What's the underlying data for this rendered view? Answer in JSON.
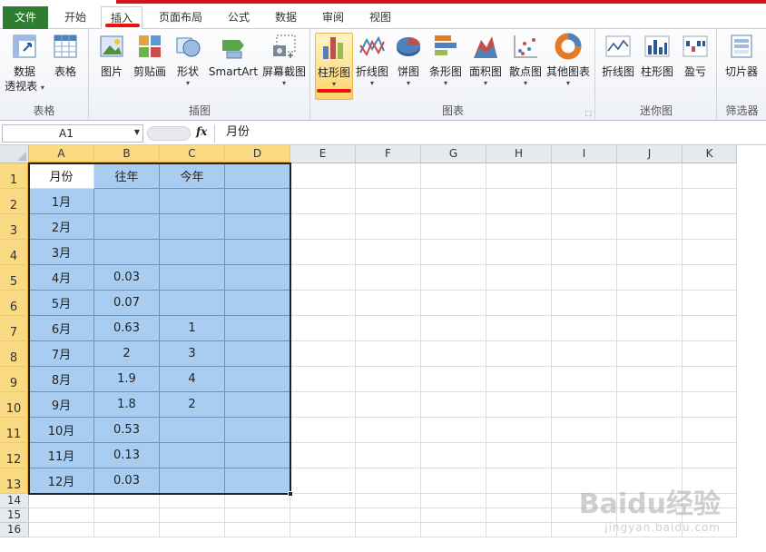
{
  "menu_tabs": {
    "file": "文件",
    "home": "开始",
    "insert": "插入",
    "page_layout": "页面布局",
    "formulas": "公式",
    "data": "数据",
    "review": "审阅",
    "view": "视图"
  },
  "ribbon": {
    "tables_group": {
      "label": "表格",
      "pivot_line1": "数据",
      "pivot_line2": "透视表",
      "table": "表格"
    },
    "illustrations_group": {
      "label": "插图",
      "picture": "图片",
      "clipart": "剪贴画",
      "shapes": "形状",
      "smartart": "SmartArt",
      "screenshot": "屏幕截图"
    },
    "charts_group": {
      "label": "图表",
      "column": "柱形图",
      "line": "折线图",
      "pie": "饼图",
      "bar": "条形图",
      "area": "面积图",
      "scatter": "散点图",
      "other": "其他图表"
    },
    "sparklines_group": {
      "label": "迷你图",
      "line": "折线图",
      "column": "柱形图",
      "winloss": "盈亏"
    },
    "filter_group": {
      "label": "筛选器",
      "slicer": "切片器"
    }
  },
  "formula_bar": {
    "name_box": "A1",
    "fx": "fx",
    "content": "月份"
  },
  "columns": [
    "A",
    "B",
    "C",
    "D",
    "E",
    "F",
    "G",
    "H",
    "I",
    "J",
    "K"
  ],
  "rows": [
    "1",
    "2",
    "3",
    "4",
    "5",
    "6",
    "7",
    "8",
    "9",
    "10",
    "11",
    "12",
    "13",
    "14",
    "15",
    "16"
  ],
  "sheet": {
    "headers": [
      "月份",
      "往年",
      "今年",
      ""
    ],
    "data": [
      [
        "1月",
        "",
        "",
        ""
      ],
      [
        "2月",
        "",
        "",
        ""
      ],
      [
        "3月",
        "",
        "",
        ""
      ],
      [
        "4月",
        "0.03",
        "",
        ""
      ],
      [
        "5月",
        "0.07",
        "",
        ""
      ],
      [
        "6月",
        "0.63",
        "1",
        ""
      ],
      [
        "7月",
        "2",
        "3",
        ""
      ],
      [
        "8月",
        "1.9",
        "4",
        ""
      ],
      [
        "9月",
        "1.8",
        "2",
        ""
      ],
      [
        "10月",
        "0.53",
        "",
        ""
      ],
      [
        "11月",
        "0.13",
        "",
        ""
      ],
      [
        "12月",
        "0.03",
        "",
        ""
      ]
    ]
  },
  "watermark": {
    "main": "Baidu经验",
    "sub": "jingyan.baidu.com"
  },
  "colors": {
    "selection_fill": "#a8cdf0",
    "header_highlight": "#f9d981",
    "file_tab": "#2f7d32",
    "annotation_red": "#e11111"
  }
}
